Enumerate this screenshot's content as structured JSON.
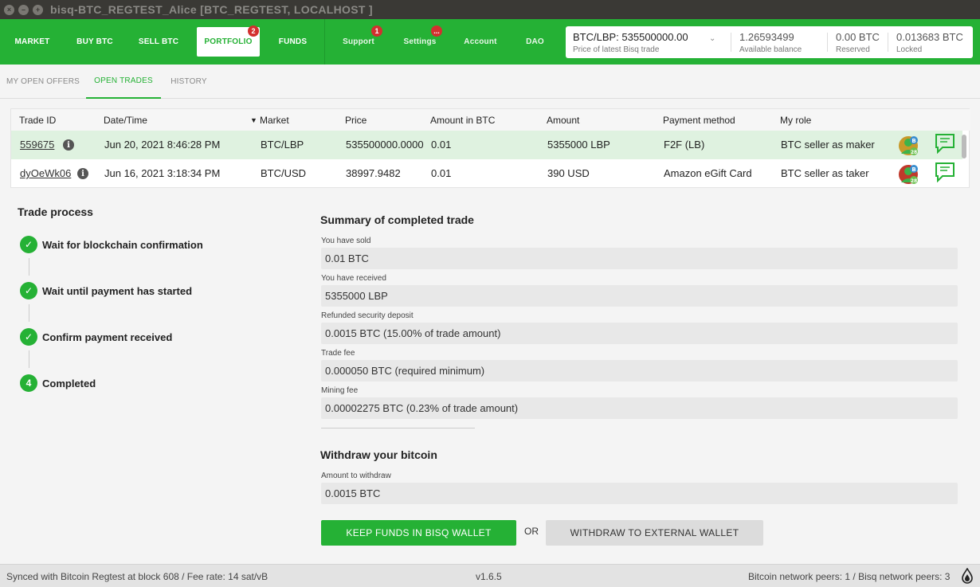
{
  "window": {
    "title": "bisq-BTC_REGTEST_Alice [BTC_REGTEST, LOCALHOST ]"
  },
  "nav": {
    "market": "MARKET",
    "buy_btc": "BUY BTC",
    "sell_btc": "SELL BTC",
    "portfolio": "PORTFOLIO",
    "portfolio_badge": "2",
    "funds": "FUNDS",
    "support": "Support",
    "support_badge": "1",
    "settings": "Settings",
    "settings_badge": "...",
    "account": "Account",
    "dao": "DAO"
  },
  "price_box": {
    "price_value": "BTC/LBP: 535500000.00",
    "price_label": "Price of latest Bisq trade",
    "available_value": "1.26593499",
    "available_label": "Available balance",
    "reserved_value": "0.00 BTC",
    "reserved_label": "Reserved",
    "locked_value": "0.013683 BTC",
    "locked_label": "Locked"
  },
  "subtabs": {
    "my_open_offers": "MY OPEN OFFERS",
    "open_trades": "OPEN TRADES",
    "history": "HISTORY"
  },
  "table": {
    "headers": {
      "trade_id": "Trade ID",
      "datetime": "Date/Time",
      "market": "Market",
      "price": "Price",
      "amount_btc": "Amount in BTC",
      "amount": "Amount",
      "payment_method": "Payment method",
      "my_role": "My role"
    },
    "rows": [
      {
        "trade_id": "559675",
        "datetime": "Jun 20, 2021 8:46:28 PM",
        "market": "BTC/LBP",
        "price": "535500000.0000",
        "amount_btc": "0.01",
        "amount": "5355000 LBP",
        "payment_method": "F2F (LB)",
        "my_role": "BTC seller as maker",
        "avatar_badge": "B",
        "avatar_count": "28"
      },
      {
        "trade_id": "dyOeWk06",
        "datetime": "Jun 16, 2021 3:18:34 PM",
        "market": "BTC/USD",
        "price": "38997.9482",
        "amount_btc": "0.01",
        "amount": "390 USD",
        "payment_method": "Amazon eGift Card",
        "my_role": "BTC seller as taker",
        "avatar_badge": "B",
        "avatar_count": "28"
      }
    ]
  },
  "trade_process": {
    "title": "Trade process",
    "steps": [
      {
        "number": "",
        "label": "Wait for blockchain confirmation"
      },
      {
        "number": "",
        "label": "Wait until payment has started"
      },
      {
        "number": "",
        "label": "Confirm payment received"
      },
      {
        "number": "4",
        "label": "Completed"
      }
    ]
  },
  "summary": {
    "title": "Summary of completed trade",
    "sold_label": "You have sold",
    "sold_value": "0.01 BTC",
    "received_label": "You have received",
    "received_value": "5355000 LBP",
    "deposit_label": "Refunded security deposit",
    "deposit_value": "0.0015 BTC (15.00% of trade amount)",
    "trade_fee_label": "Trade fee",
    "trade_fee_value": "0.000050 BTC (required minimum)",
    "mining_fee_label": "Mining fee",
    "mining_fee_value": "0.00002275 BTC (0.23% of trade amount)"
  },
  "withdraw": {
    "title": "Withdraw your bitcoin",
    "amount_label": "Amount to withdraw",
    "amount_value": "0.0015 BTC",
    "keep_button": "KEEP FUNDS IN BISQ WALLET",
    "or_text": "OR",
    "withdraw_button": "WITHDRAW TO EXTERNAL WALLET"
  },
  "footer": {
    "sync_status": "Synced with Bitcoin Regtest at block 608 / Fee rate: 14 sat/vB",
    "version": "v1.6.5",
    "peers": "Bitcoin network peers: 1 / Bisq network peers: 3"
  },
  "colors": {
    "accent": "#25b135",
    "badge": "#d3302f"
  }
}
